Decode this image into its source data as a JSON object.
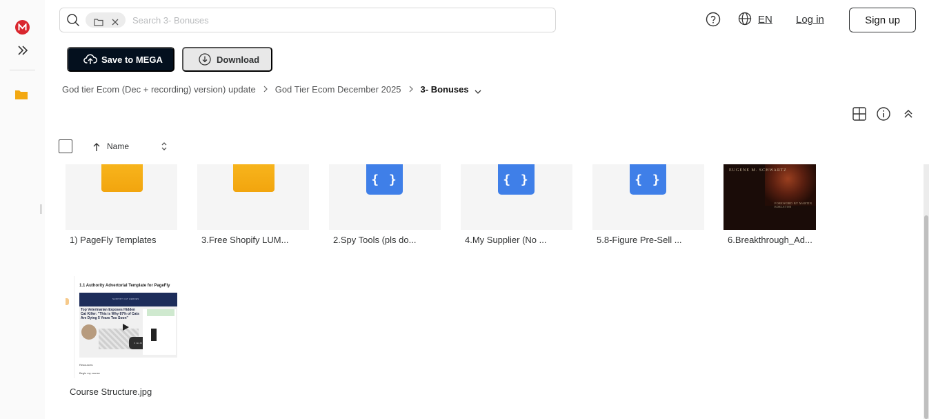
{
  "search": {
    "placeholder": "Search 3- Bonuses",
    "scope_chip": {
      "icon": "folder-icon",
      "clear_icon": "close-icon"
    }
  },
  "header": {
    "help_icon": "help-circle-icon",
    "language_icon": "globe-icon",
    "language": "EN",
    "login_label": "Log in",
    "signup_label": "Sign up"
  },
  "toolbar": {
    "save_label": "Save to MEGA",
    "download_label": "Download"
  },
  "breadcrumb": [
    "God tier Ecom (Dec + recording) version) update",
    "God Tier Ecom December 2025",
    "3- Bonuses"
  ],
  "list_header": {
    "name_label": "Name",
    "sort": "ascending"
  },
  "view_controls": [
    "grid-view-icon",
    "info-icon",
    "collapse-icon"
  ],
  "items": [
    {
      "label": "1) PageFly Templates",
      "type": "folder"
    },
    {
      "label": "3.Free Shopify LUM...",
      "type": "folder"
    },
    {
      "label": "2.Spy Tools (pls do...",
      "type": "code"
    },
    {
      "label": "4.My Supplier (No ...",
      "type": "code"
    },
    {
      "label": "5.8-Figure Pre-Sell ...",
      "type": "code"
    },
    {
      "label": "6.Breakthrough_Ad...",
      "type": "image"
    },
    {
      "label": "Course Structure.jpg",
      "type": "image"
    }
  ],
  "thumbnails": {
    "book_author": "EUGENE M. SCHWARTZ",
    "book_foreword": "FOREWORD BY MARTIN EDELSTON",
    "course_title": "1.1 Authority Advertorial Template for PageFly",
    "course_bar": "SHOPIFY CAT HEROES",
    "course_headline": "Top Veterinarian Exposes Hidden Cat Killer: \"This is Why 87% of Cats Are Dying 5 Years Too Soon\"",
    "course_timer": "3 min 42 sec",
    "course_footer1": "Resources:",
    "course_footer2": "Begin my course"
  },
  "colors": {
    "brand_red": "#d9272e",
    "primary_button": "#04101e",
    "folder_yellow": "#f7b41c",
    "code_blue": "#3f7fe8"
  }
}
